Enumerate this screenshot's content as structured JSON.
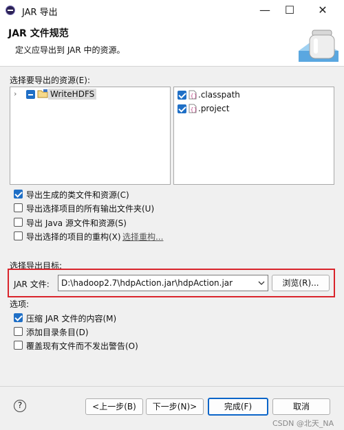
{
  "window": {
    "title": "JAR 导出",
    "minimize_glyph": "—",
    "maximize_glyph": "☐",
    "close_glyph": "✕"
  },
  "banner": {
    "title": "JAR 文件规范",
    "description": "定义应导出到 JAR 中的资源。",
    "icon": "jar-icon"
  },
  "resources": {
    "label": "选择要导出的资源(E):",
    "tree": [
      {
        "label": "WriteHDFS",
        "icon": "project-folder-icon",
        "state": "partial",
        "expanded": false
      }
    ],
    "files": [
      {
        "label": ".classpath",
        "checked": true,
        "icon": "file-icon"
      },
      {
        "label": ".project",
        "checked": true,
        "icon": "file-icon"
      }
    ]
  },
  "export_options": [
    {
      "label": "导出生成的类文件和资源(C)",
      "checked": true
    },
    {
      "label": "导出选择项目的所有输出文件夹(U)",
      "checked": false
    },
    {
      "label": "导出 Java 源文件和资源(S)",
      "checked": false
    },
    {
      "label": "导出选择的项目的重构(X)",
      "checked": false,
      "link": "选择重构..."
    }
  ],
  "destination": {
    "label": "选择导出目标:",
    "jar_label": "JAR 文件:",
    "jar_path": "D:\\hadoop2.7\\hdpAction.jar\\hdpAction.jar",
    "browse": "浏览(R)..."
  },
  "options": {
    "label": "选项:",
    "items": [
      {
        "label": "压缩 JAR 文件的内容(M)",
        "checked": true
      },
      {
        "label": "添加目录条目(D)",
        "checked": false
      },
      {
        "label": "覆盖现有文件而不发出警告(O)",
        "checked": false
      }
    ]
  },
  "footer": {
    "help": "?",
    "back": "<上一步(B)",
    "next": "下一步(N)>",
    "finish": "完成(F)",
    "cancel": "取消"
  },
  "watermark": "CSDN @北天_NA",
  "colors": {
    "accent": "#1f6fc6",
    "highlight": "#d9232a"
  }
}
